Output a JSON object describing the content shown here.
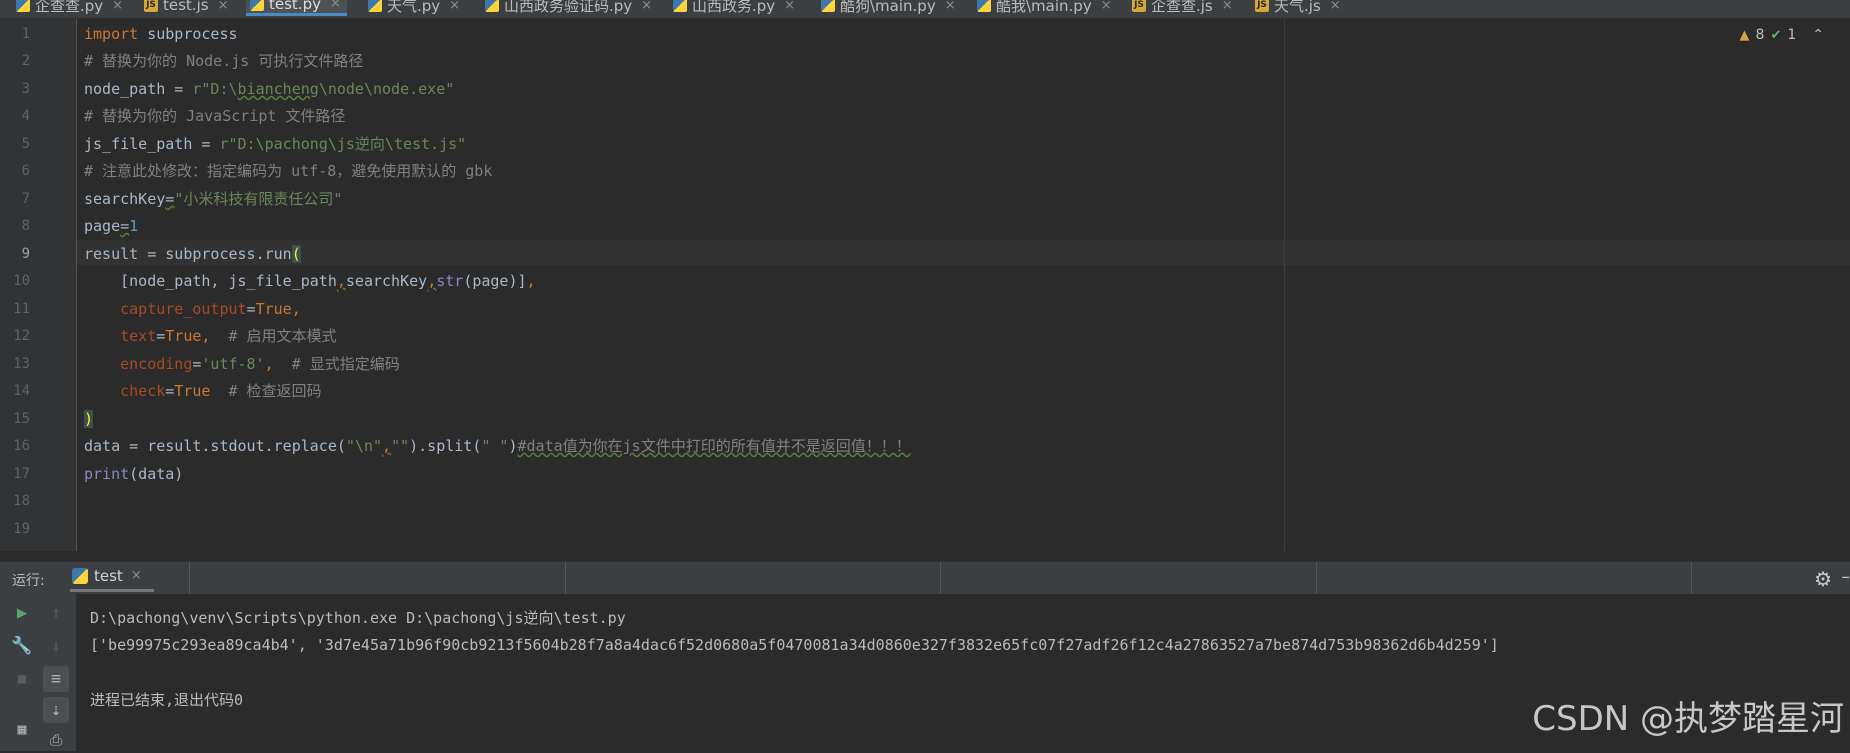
{
  "tabs": [
    {
      "label": "企查查.py",
      "icon": "python-file-icon",
      "kind": "py"
    },
    {
      "label": "test.js",
      "icon": "js-file-icon",
      "kind": "js"
    },
    {
      "label": "test.py",
      "icon": "python-file-icon",
      "kind": "py",
      "active": true
    },
    {
      "label": "天气.py",
      "icon": "python-file-icon",
      "kind": "py"
    },
    {
      "label": "山西政务验证码.py",
      "icon": "python-file-icon",
      "kind": "py"
    },
    {
      "label": "山西政务.py",
      "icon": "python-file-icon",
      "kind": "py"
    },
    {
      "label": "酷狗\\main.py",
      "icon": "python-file-icon",
      "kind": "py"
    },
    {
      "label": "酷我\\main.py",
      "icon": "python-file-icon",
      "kind": "py"
    },
    {
      "label": "企查查.js",
      "icon": "js-file-icon",
      "kind": "js"
    },
    {
      "label": "天气.js",
      "icon": "js-file-icon",
      "kind": "js"
    }
  ],
  "tab_close_glyph": "×",
  "inspections": {
    "warnings": "8",
    "ok": "1"
  },
  "line_numbers": [
    "1",
    "2",
    "3",
    "4",
    "5",
    "6",
    "7",
    "8",
    "9",
    "10",
    "11",
    "12",
    "13",
    "14",
    "15",
    "16",
    "17",
    "18",
    "19"
  ],
  "current_line": "9",
  "code": {
    "l1_kw": "import",
    "l1_rest": " subprocess",
    "l2": "# 替换为你的 Node.js 可执行文件路径",
    "l3_a": "node_path = ",
    "l3_str1": "r\"D:\\",
    "l3_sq": "biancheng",
    "l3_str2": "\\node\\node.exe\"",
    "l4": "# 替换为你的 JavaScript 文件路径",
    "l5_a": "js_file_path = ",
    "l5_str": "r\"D:\\pachong\\js逆向\\test.js\"",
    "l6": "# 注意此处修改：指定编码为 utf-8，避免使用默认的 gbk",
    "l7_a": "searchKey",
    "l7_eq": "=",
    "l7_str": "\"小米科技有限责任公司\"",
    "l8_a": "page",
    "l8_eq": "=",
    "l8_num": "1",
    "l9_a": "result = subprocess.run",
    "l9_paren": "(",
    "l10_a": "    [node_path, js_file_path",
    "l10_c1": ",",
    "l10_b": "searchKey",
    "l10_c2": ",",
    "l10_bi": "str",
    "l10_c": "(page)]",
    "l10_c3": ",",
    "l11_p": "    capture_output",
    "l11_eq": "=",
    "l11_v": "True",
    "l11_c": ",",
    "l12_p": "    text",
    "l12_eq": "=",
    "l12_v": "True",
    "l12_c": ",",
    "l12_com": "  # 启用文本模式",
    "l13_p": "    encoding",
    "l13_eq": "=",
    "l13_v": "'utf-8'",
    "l13_c": ",",
    "l13_com": "  # 显式指定编码",
    "l14_p": "    check",
    "l14_eq": "=",
    "l14_v": "True",
    "l14_com": "  # 检查返回码",
    "l15": ")",
    "l16_a": "data = result.stdout.replace(",
    "l16_s1": "\"\\n\"",
    "l16_c": ",",
    "l16_s2": "\"\"",
    "l16_b": ").split(",
    "l16_s3": "\" \"",
    "l16_d": ")",
    "l16_com": "#data值为你在js文件中打印的所有值并不是返回值！！！",
    "l17_bi": "print",
    "l17_rest": "(data)"
  },
  "run_panel": {
    "label": "运行:",
    "tab": "test",
    "output": [
      "D:\\pachong\\venv\\Scripts\\python.exe D:\\pachong\\js逆向\\test.py",
      "['be99975c293ea89ca4b4', '3d7e45a71b96f90cb9213f5604b28f7a8a4dac6f52d0680a5f0470081a34d0860e327f3832e65fc07f27adf26f12c4a27863527a7be874d753b98362d6b4d259']",
      "",
      "进程已结束,退出代码0"
    ]
  },
  "watermark": "CSDN @执梦踏星河",
  "colors": {
    "keyword": "#cc7832",
    "string": "#6a8759",
    "comment": "#808080",
    "number": "#6897bb",
    "param": "#aa4926",
    "tab_accent": "#4a88c7"
  }
}
